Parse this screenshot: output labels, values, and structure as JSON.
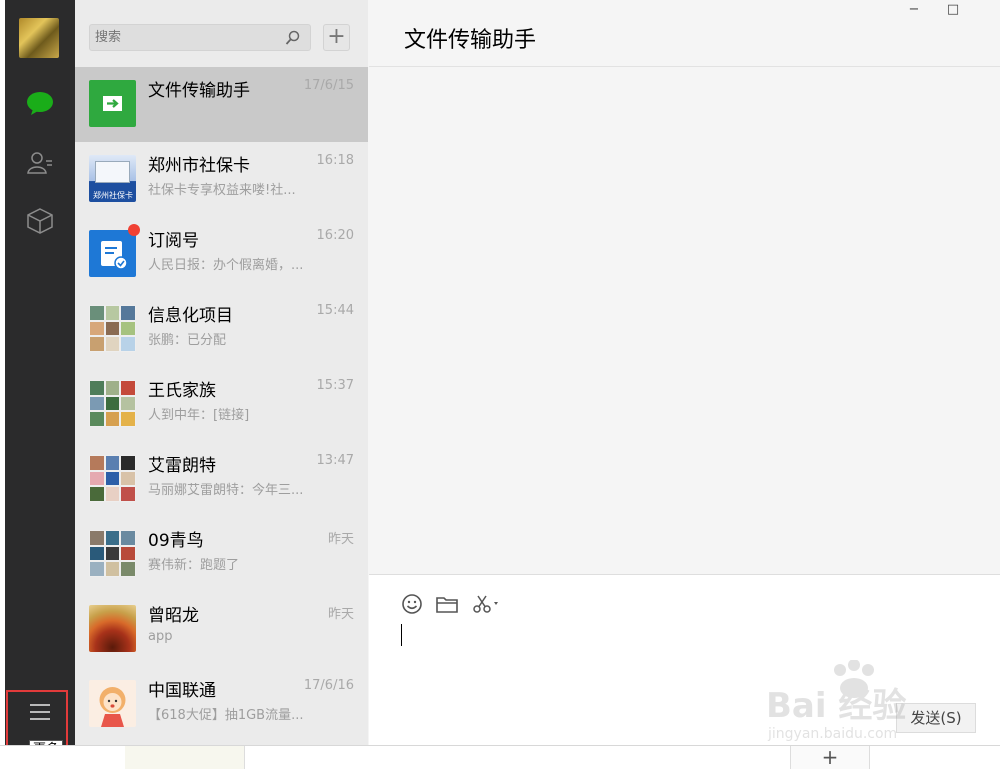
{
  "sidebar": {
    "more_tooltip": "更多",
    "accent_color": "#1aad19"
  },
  "search": {
    "placeholder": "搜索",
    "add_label": "+"
  },
  "chats": [
    {
      "name": "文件传输助手",
      "time": "17/6/15",
      "preview": ""
    },
    {
      "name": "郑州市社保卡",
      "time": "16:18",
      "preview": "社保卡专享权益来喽!社..."
    },
    {
      "name": "订阅号",
      "time": "16:20",
      "preview": "人民日报：办个假离婚，..."
    },
    {
      "name": "信息化项目",
      "time": "15:44",
      "preview": "张鹏：已分配"
    },
    {
      "name": "王氏家族",
      "time": "15:37",
      "preview": "人到中年：[链接]"
    },
    {
      "name": "艾雷朗特",
      "time": "13:47",
      "preview": "马丽娜艾雷朗特：今年三..."
    },
    {
      "name": "09青鸟",
      "time": "昨天",
      "preview": "赛伟新：跑题了"
    },
    {
      "name": "曾昭龙",
      "time": "昨天",
      "preview": "app"
    },
    {
      "name": "中国联通",
      "time": "17/6/16",
      "preview": "【618大促】抽1GB流量..."
    }
  ],
  "avatar_caption": "郑州社保卡",
  "main": {
    "title": "文件传输助手",
    "send_label": "发送(S)"
  },
  "window": {
    "minimize": "−",
    "maximize": "□"
  },
  "taskbar": {
    "plus": "+"
  },
  "watermark": {
    "logo": "Bai  经验",
    "url": "jingyan.baidu.com"
  }
}
